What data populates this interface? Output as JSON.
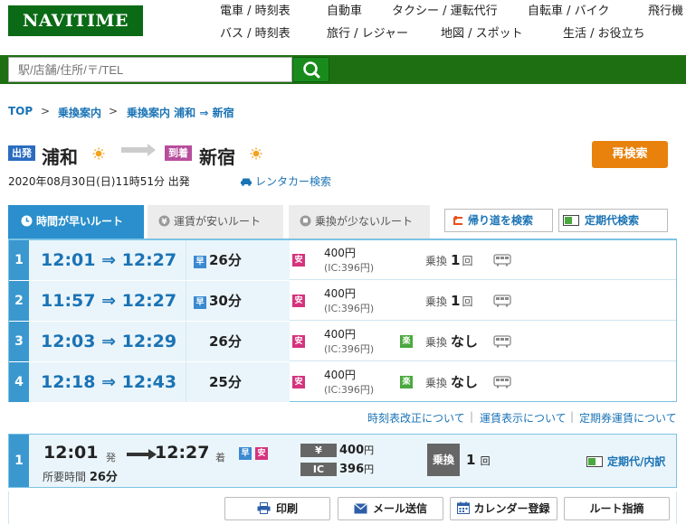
{
  "header": {
    "logo": "NAVITIME",
    "nav": [
      {
        "label": "電車 / 時刻表"
      },
      {
        "label": "自動車"
      },
      {
        "label": "タクシー / 運転代行"
      },
      {
        "label": "自転車 / バイク"
      },
      {
        "label": "飛行機"
      },
      {
        "label": "バス / 時刻表"
      },
      {
        "label": "旅行 / レジャー"
      },
      {
        "label": "地図 / スポット"
      },
      {
        "label": "生活 / お役立ち"
      }
    ]
  },
  "search": {
    "placeholder": "駅/店舗/住所/〒/TEL"
  },
  "breadcrumb": [
    "TOP",
    "乗換案内",
    "乗換案内 浦和 ⇒ 新宿"
  ],
  "trip": {
    "from_tag": "出発",
    "from": "浦和",
    "to_tag": "到着",
    "to": "新宿",
    "research_label": "再検索",
    "datetime": "2020年08月30日(日)11時51分 出発",
    "rental_link": "レンタカー検索"
  },
  "tabs": [
    {
      "label": "時間が早いルート"
    },
    {
      "label": "運賃が安いルート"
    },
    {
      "label": "乗換が少ないルート"
    }
  ],
  "tab_buttons": {
    "return": "帰り道を検索",
    "commuter": "定期代検索"
  },
  "routes": [
    {
      "num": "1",
      "time": "12:01 ⇒ 12:27",
      "badge": "早",
      "duration": "26分",
      "fare": "400円",
      "ic": "(IC:396円)",
      "extra_badge": "",
      "transfer_label": "乗換",
      "transfers": "1",
      "transfer_unit": "回"
    },
    {
      "num": "2",
      "time": "11:57 ⇒ 12:27",
      "badge": "早",
      "duration": "30分",
      "fare": "400円",
      "ic": "(IC:396円)",
      "extra_badge": "",
      "transfer_label": "乗換",
      "transfers": "1",
      "transfer_unit": "回"
    },
    {
      "num": "3",
      "time": "12:03 ⇒ 12:29",
      "badge": "",
      "duration": "26分",
      "fare": "400円",
      "ic": "(IC:396円)",
      "extra_badge": "楽",
      "transfer_label": "乗換",
      "transfers": "なし",
      "transfer_unit": ""
    },
    {
      "num": "4",
      "time": "12:18 ⇒ 12:43",
      "badge": "",
      "duration": "25分",
      "fare": "400円",
      "ic": "(IC:396円)",
      "extra_badge": "楽",
      "transfer_label": "乗換",
      "transfers": "なし",
      "transfer_unit": ""
    }
  ],
  "cheap_badge": "安",
  "notes": [
    "時刻表改正について",
    "運賃表示について",
    "定期券運賃について"
  ],
  "selected": {
    "num": "1",
    "dep": "12:01",
    "dep_suffix": "発",
    "arr": "12:27",
    "arr_suffix": "着",
    "badge_fast": "早",
    "badge_cheap": "安",
    "req_label": "所要時間",
    "req_value": "26分",
    "fare_label_yen": "¥",
    "fare_yen": "400",
    "fare_label_ic": "IC",
    "fare_ic": "396",
    "fare_unit": "円",
    "transfer_label": "乗換",
    "transfers": "1",
    "transfer_unit": "回",
    "teiki": "定期代/内訳"
  },
  "actions": {
    "print": "印刷",
    "mail": "メール送信",
    "calendar": "カレンダー登録",
    "route": "ルート指摘"
  },
  "colors": {
    "brand": "#0b6a15",
    "accent": "#2a8fcc",
    "link": "#1a73b5",
    "research": "#e8820c",
    "cheap": "#d5337e",
    "fast": "#3a8ad1",
    "easy": "#4aa83e"
  }
}
